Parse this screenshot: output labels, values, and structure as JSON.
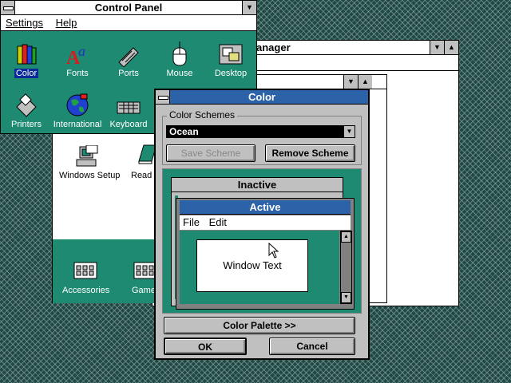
{
  "control_panel": {
    "title": "Control Panel",
    "menu": [
      "Settings",
      "Help"
    ],
    "icons": [
      {
        "name": "color-icon",
        "label": "Color",
        "selected": true
      },
      {
        "name": "fonts-icon",
        "label": "Fonts"
      },
      {
        "name": "ports-icon",
        "label": "Ports"
      },
      {
        "name": "mouse-icon",
        "label": "Mouse"
      },
      {
        "name": "desktop-icon",
        "label": "Desktop"
      },
      {
        "name": "printers-icon",
        "label": "Printers"
      },
      {
        "name": "international-icon",
        "label": "International"
      },
      {
        "name": "keyboard-icon",
        "label": "Keyboard"
      }
    ]
  },
  "program_manager": {
    "title_fragment": "anager",
    "group_icons": [
      {
        "label": "Windows Setup"
      },
      {
        "label": "Read"
      }
    ],
    "bottom_icons": [
      {
        "label": "Accessories"
      },
      {
        "label": "Game"
      }
    ]
  },
  "color_dialog": {
    "title": "Color",
    "schemes_label": "Color Schemes",
    "selected_scheme": "Ocean",
    "save_button": "Save Scheme",
    "remove_button": "Remove Scheme",
    "preview": {
      "inactive_title": "Inactive",
      "active_title": "Active",
      "menu": [
        "File",
        "Edit"
      ],
      "window_text": "Window Text"
    },
    "palette_button": "Color Palette >>",
    "ok_button": "OK",
    "cancel_button": "Cancel"
  }
}
